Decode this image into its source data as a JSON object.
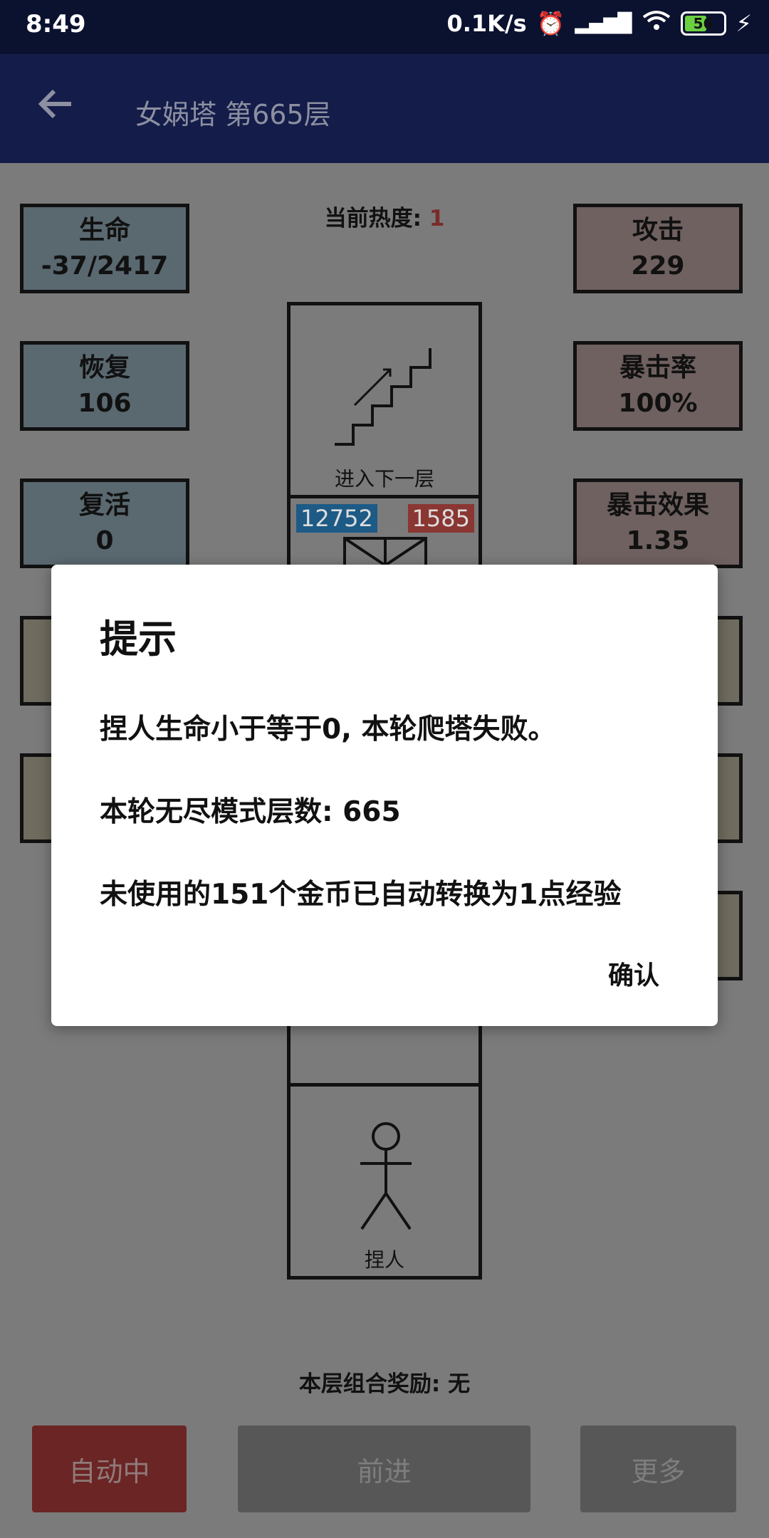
{
  "status_bar": {
    "time": "8:49",
    "net_speed": "0.1K/s",
    "battery": "56"
  },
  "app_bar": {
    "title": "女娲塔 第665层",
    "back_icon": "arrow-left-icon"
  },
  "heat": {
    "label": "当前热度:",
    "value": "1"
  },
  "left_stats": [
    {
      "label": "生命",
      "value": "-37/2417"
    },
    {
      "label": "恢复",
      "value": "106"
    },
    {
      "label": "复活",
      "value": "0"
    }
  ],
  "right_stats": [
    {
      "label": "攻击",
      "value": "229"
    },
    {
      "label": "暴击率",
      "value": "100%"
    },
    {
      "label": "暴击效果",
      "value": "1.35"
    }
  ],
  "tower": {
    "next_floor_label": "进入下一层",
    "enemy_hp_blue": "12752",
    "enemy_hp_red": "1585",
    "player_label": "捏人"
  },
  "combo": {
    "text": "本层组合奖励: 无"
  },
  "buttons": {
    "auto": "自动中",
    "forward": "前进",
    "more": "更多"
  },
  "dialog": {
    "title": "提示",
    "line1": "捏人生命小于等于0, 本轮爬塔失败。",
    "line2": "本轮无尽模式层数: 665",
    "line3": "未使用的151个金币已自动转换为1点经验",
    "confirm": "确认"
  },
  "colors": {
    "appbar": "#141c49",
    "status": "#0b1230",
    "hp_blue": "#1d5a86",
    "hp_red": "#8a3632",
    "auto_btn": "#6b2524"
  }
}
